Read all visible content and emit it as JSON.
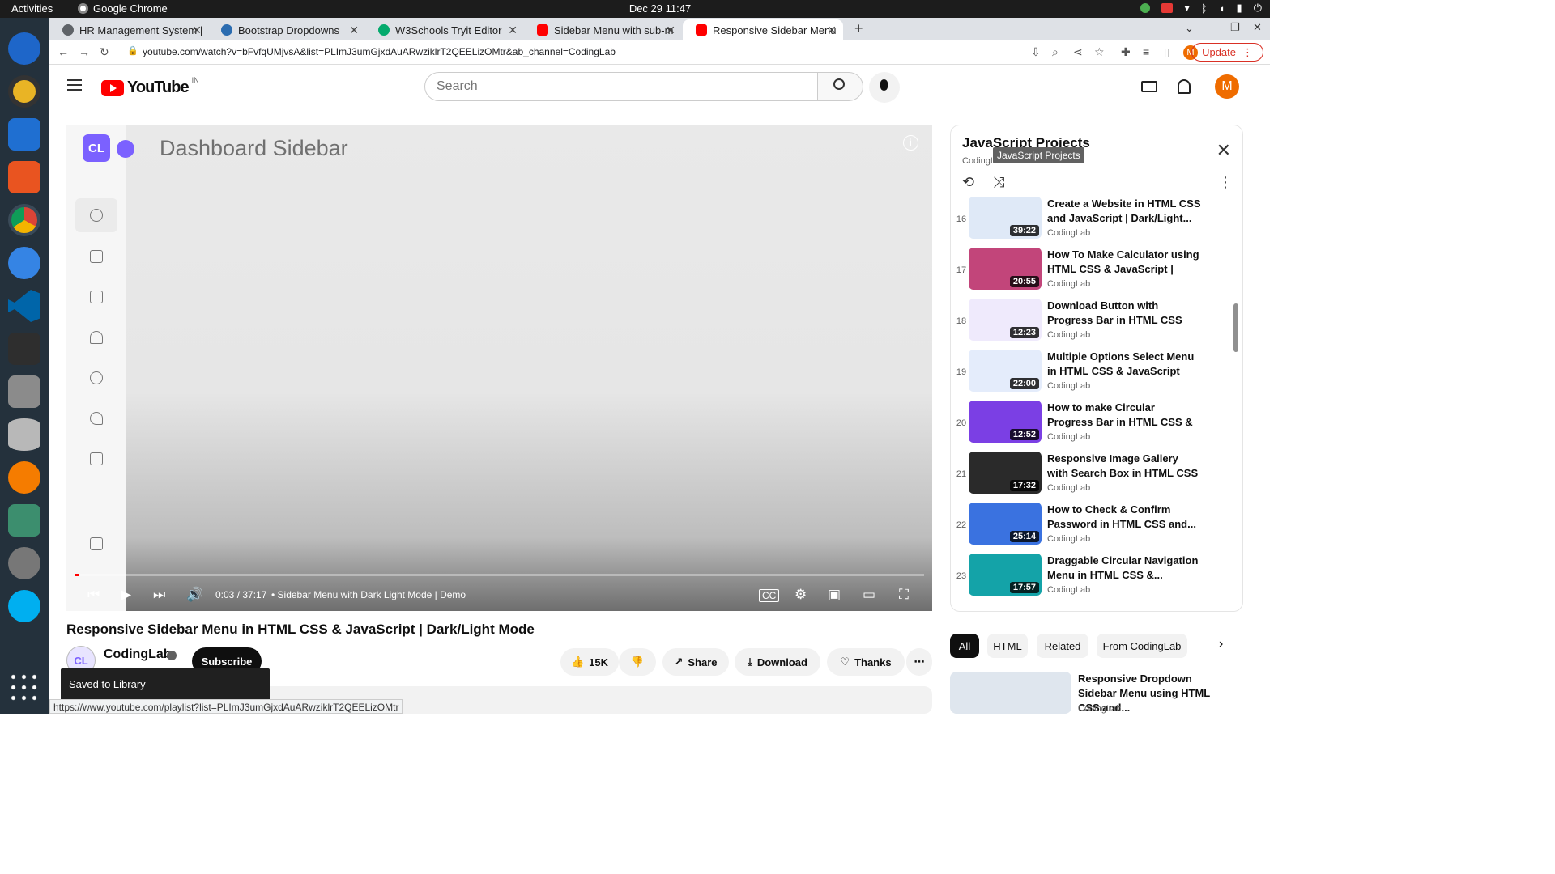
{
  "system": {
    "activities": "Activities",
    "app": "Google Chrome",
    "clock": "Dec 29  11:47"
  },
  "tabs": [
    {
      "label": "HR Management System |",
      "color": "#5f6368"
    },
    {
      "label": "Bootstrap Dropdowns",
      "color": "#2b6cb0"
    },
    {
      "label": "W3Schools Tryit Editor",
      "color": "#04aa6d"
    },
    {
      "label": "Sidebar Menu with sub-m",
      "color": "#ff0000"
    },
    {
      "label": "Responsive Sidebar Menu",
      "color": "#ff0000"
    }
  ],
  "address": {
    "url": "youtube.com/watch?v=bFvfqUMjvsA&list=PLImJ3umGjxdAuARwziklrT2QEELizOMtr&ab_channel=CodingLab",
    "update": "Update",
    "profile_initial": "M"
  },
  "youtube": {
    "logo_text": "YouTube",
    "country": "IN",
    "search_placeholder": "Search",
    "avatar": "M",
    "player": {
      "demo_logo": "CL",
      "demo_title": "Dashboard Sidebar",
      "info": "i",
      "time": "0:03 / 37:17",
      "chapter": "• Sidebar Menu with Dark Light Mode | Demo",
      "progress": 0.0013
    },
    "video_title": "Responsive Sidebar Menu in HTML CSS & JavaScript | Dark/Light Mode",
    "channel": {
      "avatar": "CL",
      "name": "CodingLab"
    },
    "actions": {
      "subscribe": "Subscribe",
      "likes": "15K",
      "share": "Share",
      "download": "Download",
      "thanks": "Thanks"
    },
    "toast": "Saved to Library",
    "status_url": "https://www.youtube.com/playlist?list=PLImJ3umGjxdAuARwziklrT2QEELizOMtr",
    "playlist": {
      "title": "JavaScript Projects",
      "subtitle": "CodingLab",
      "tooltip": "JavaScript Projects",
      "items": [
        {
          "num": "16",
          "title": "Create a Website in HTML CSS and JavaScript | Dark/Light...",
          "channel": "CodingLab",
          "duration": "39:22",
          "thumb": "#dfe9f7"
        },
        {
          "num": "17",
          "title": "How To Make Calculator using HTML CSS & JavaScript | Gla...",
          "channel": "CodingLab",
          "duration": "20:55",
          "thumb": "#c2457a"
        },
        {
          "num": "18",
          "title": "Download Button with Progress Bar in HTML CSS an...",
          "channel": "CodingLab",
          "duration": "12:23",
          "thumb": "#efeafc"
        },
        {
          "num": "19",
          "title": "Multiple Options Select Menu in HTML CSS & JavaScript",
          "channel": "CodingLab",
          "duration": "22:00",
          "thumb": "#e4ecfb"
        },
        {
          "num": "20",
          "title": "How to make Circular Progress Bar in HTML CSS & JavaScrip...",
          "channel": "CodingLab",
          "duration": "12:52",
          "thumb": "#7b3fe4"
        },
        {
          "num": "21",
          "title": "Responsive Image Gallery with Search Box in HTML CSS &...",
          "channel": "CodingLab",
          "duration": "17:32",
          "thumb": "#2a2a2a"
        },
        {
          "num": "22",
          "title": "How to Check & Confirm Password in HTML CSS and...",
          "channel": "CodingLab",
          "duration": "25:14",
          "thumb": "#3a72e0"
        },
        {
          "num": "23",
          "title": "Draggable Circular Navigation Menu in HTML CSS &...",
          "channel": "CodingLab",
          "duration": "17:57",
          "thumb": "#14a3a8"
        }
      ]
    },
    "chips": [
      "All",
      "HTML",
      "Related",
      "From CodingLab"
    ],
    "recommended": {
      "title": "Responsive Dropdown Sidebar Menu using HTML CSS and...",
      "channel": "CodingLab"
    }
  }
}
